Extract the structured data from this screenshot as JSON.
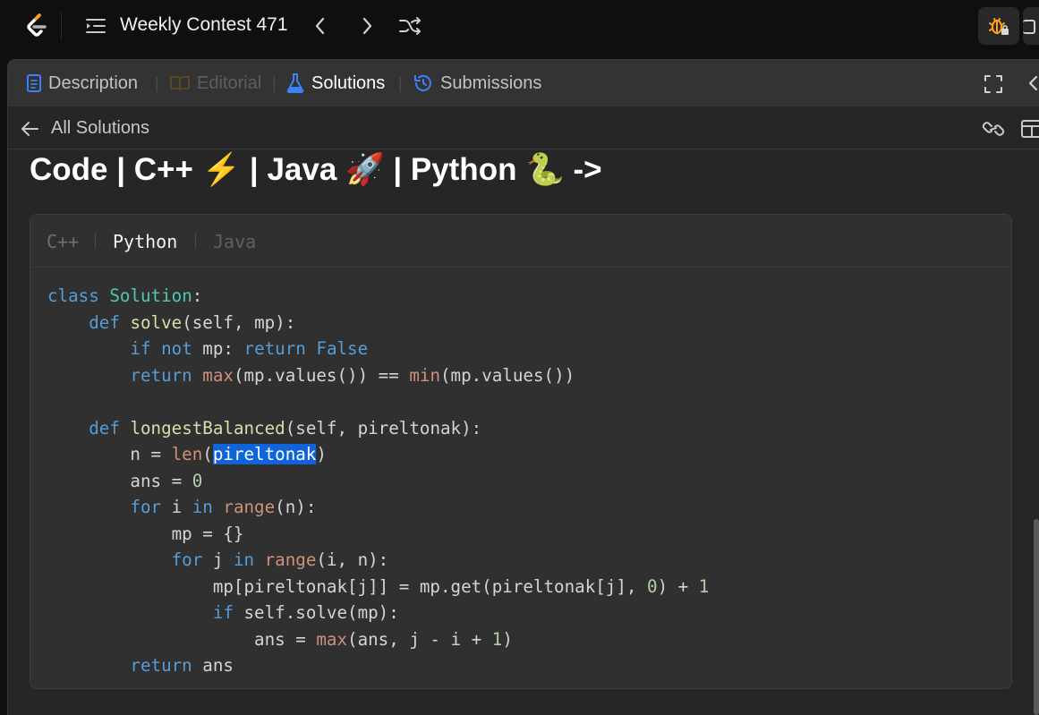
{
  "topbar": {
    "contest_title": "Weekly Contest 471",
    "icons": [
      "leetcode-logo",
      "problem-list-icon",
      "chevron-left-icon",
      "chevron-right-icon",
      "shuffle-icon",
      "debug-icon",
      "panel-icon"
    ],
    "accent": "#ffa116"
  },
  "tabs": {
    "description": "Description",
    "editorial": "Editorial",
    "solutions": "Solutions",
    "submissions": "Submissions",
    "separator": "|"
  },
  "subbar": {
    "back_label": "All Solutions"
  },
  "solution": {
    "heading": "Code | C++ ⚡ | Java 🚀 | Python 🐍 ->"
  },
  "code": {
    "languages": [
      "C++",
      "Python",
      "Java"
    ],
    "active_language": "Python",
    "selected_token": "pireltonak",
    "lines": [
      "class Solution:",
      "    def solve(self, mp):",
      "        if not mp: return False",
      "        return max(mp.values()) == min(mp.values())",
      "",
      "    def longestBalanced(self, pireltonak):",
      "        n = len(pireltonak)",
      "        ans = 0",
      "        for i in range(n):",
      "            mp = {}",
      "            for j in range(i, n):",
      "                mp[pireltonak[j]] = mp.get(pireltonak[j], 0) + 1",
      "                if self.solve(mp):",
      "                    ans = max(ans, j - i + 1)",
      "        return ans"
    ]
  },
  "colors": {
    "keyword": "#569cd6",
    "class_name": "#4ec9b0",
    "function": "#dcdcaa",
    "builtin": "#ce9178",
    "number": "#b5cea8",
    "selection": "#0e64d8"
  }
}
